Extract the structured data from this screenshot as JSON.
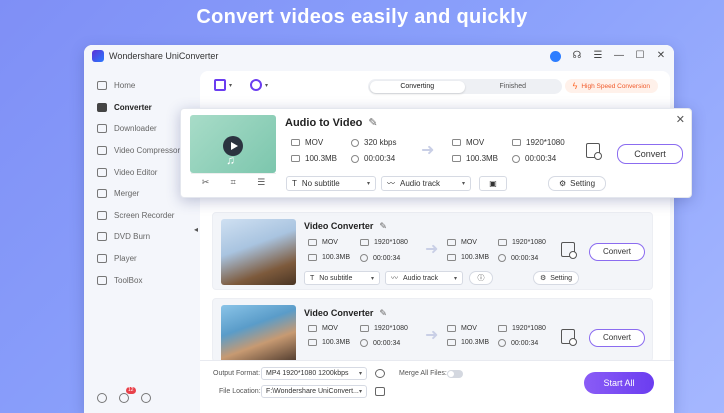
{
  "headline": "Convert videos easily and quickly",
  "app": {
    "title": "Wondershare UniConverter"
  },
  "sidebar": {
    "items": [
      {
        "label": "Home",
        "icon": "home-icon"
      },
      {
        "label": "Converter",
        "icon": "converter-icon",
        "active": true
      },
      {
        "label": "Downloader",
        "icon": "downloader-icon"
      },
      {
        "label": "Video Compressor",
        "icon": "compress-icon"
      },
      {
        "label": "Video Editor",
        "icon": "editor-icon"
      },
      {
        "label": "Merger",
        "icon": "merger-icon"
      },
      {
        "label": "Screen Recorder",
        "icon": "recorder-icon"
      },
      {
        "label": "DVD Burn",
        "icon": "dvd-icon"
      },
      {
        "label": "Player",
        "icon": "player-icon"
      },
      {
        "label": "ToolBox",
        "icon": "toolbox-icon"
      }
    ],
    "notification_count": "12"
  },
  "tabs": {
    "converting": "Converting",
    "finished": "Finished"
  },
  "high_speed": "High Speed Conversion",
  "popup": {
    "title": "Audio to Video",
    "src_format": "MOV",
    "src_size": "100.3MB",
    "bitrate": "320 kbps",
    "src_duration": "00:00:34",
    "dst_format": "MOV",
    "dst_size": "100.3MB",
    "dst_resolution": "1920*1080",
    "dst_duration": "00:00:34",
    "convert_label": "Convert",
    "subtitle": "No subtitle",
    "audio": "Audio track",
    "setting": "Setting"
  },
  "items": [
    {
      "title": "Video Converter",
      "src_format": "MOV",
      "src_size": "100.3MB",
      "src_res": "1920*1080",
      "src_duration": "00:00:34",
      "dst_format": "MOV",
      "dst_size": "100.3MB",
      "dst_res": "1920*1080",
      "dst_duration": "00:00:34",
      "convert_label": "Convert",
      "subtitle": "No subtitle",
      "audio": "Audio track",
      "setting": "Setting"
    },
    {
      "title": "Video Converter",
      "src_format": "MOV",
      "src_size": "100.3MB",
      "src_res": "1920*1080",
      "src_duration": "00:00:34",
      "dst_format": "MOV",
      "dst_size": "100.3MB",
      "dst_res": "1920*1080",
      "dst_duration": "00:00:34",
      "convert_label": "Convert"
    }
  ],
  "footer": {
    "output_label": "Output Format:",
    "output_value": "MP4 1920*1080 1200kbps",
    "merge_label": "Merge All Files:",
    "location_label": "File Location:",
    "location_value": "F:\\Wondershare UniConvert...",
    "start_all": "Start All"
  },
  "colors": {
    "accent": "#6b3df0",
    "orange": "#f05a2a",
    "bg": "#8a9cfa"
  }
}
